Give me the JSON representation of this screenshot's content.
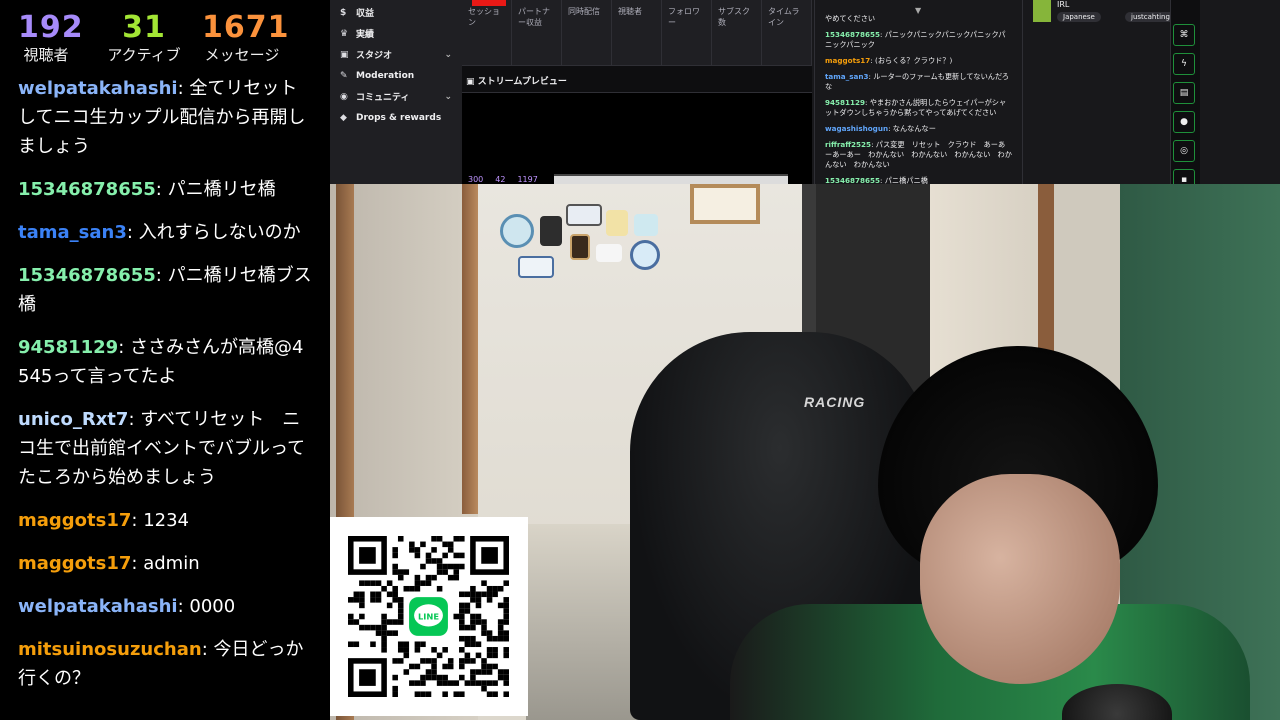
{
  "stats": {
    "viewers": {
      "value": "192",
      "label": "視聴者",
      "color": "#a78bfa"
    },
    "active": {
      "value": "31",
      "label": "アクティブ",
      "color": "#a3e635"
    },
    "messages": {
      "value": "1671",
      "label": "メッセージ",
      "color": "#fb923c"
    }
  },
  "chat": [
    {
      "user": "welpatakahashi",
      "color": "#8ab4f8",
      "text": "全てリセットしてニコ生カップル配信から再開しましょう"
    },
    {
      "user": "15346878655",
      "color": "#86efac",
      "text": "パニ橋リセ橋"
    },
    {
      "user": "tama_san3",
      "color": "#3b82f6",
      "text": "入れすらしないのか"
    },
    {
      "user": "15346878655",
      "color": "#86efac",
      "text": "パニ橋リセ橋ブス橋"
    },
    {
      "user": "94581129",
      "color": "#86efac",
      "text": "ささみさんが高橋@4545って言ってたよ"
    },
    {
      "user": "unico_Rxt7",
      "color": "#bfdbfe",
      "text": "すべてリセット　ニコ生で出前館イベントでバブルってたころから始めましょう"
    },
    {
      "user": "maggots17",
      "color": "#f59e0b",
      "text": "1234"
    },
    {
      "user": "maggots17",
      "color": "#f59e0b",
      "text": "admin"
    },
    {
      "user": "welpatakahashi",
      "color": "#8ab4f8",
      "text": "0000"
    },
    {
      "user": "mitsuinosuzuchan",
      "color": "#f59e0b",
      "text": "今日どっか行くの？"
    }
  ],
  "dashboard": {
    "nav": [
      {
        "icon": "$",
        "label": "収益",
        "chevron": ""
      },
      {
        "icon": "♛",
        "label": "実績",
        "chevron": ""
      },
      {
        "icon": "▣",
        "label": "スタジオ",
        "chevron": "⌄"
      },
      {
        "icon": "✎",
        "label": "Moderation",
        "chevron": ""
      },
      {
        "icon": "◉",
        "label": "コミュニティ",
        "chevron": "⌄"
      },
      {
        "icon": "◆",
        "label": "Drops & rewards",
        "chevron": ""
      }
    ],
    "metric_tabs": [
      "セッション",
      "パートナー収益",
      "同時配信",
      "視聴者",
      "フォロワー",
      "サブスク数",
      "タイムライン"
    ],
    "preview_title": "▣ ストリームプレビュー",
    "mini_stats": [
      "300",
      "42",
      "1197"
    ],
    "chat": [
      {
        "user": "",
        "color": "#efeff1",
        "text": "やめてください"
      },
      {
        "user": "15346878655",
        "color": "#86efac",
        "text": "パニックパニックパニックパニックパニックパニック"
      },
      {
        "user": "maggots17",
        "color": "#f59e0b",
        "text": "(おらくる？クラウド？)"
      },
      {
        "user": "tama_san3",
        "color": "#60a5fa",
        "text": "ルーターのファームも更新してないんだろな"
      },
      {
        "user": "94581129",
        "color": "#86efac",
        "text": "やまおかさん説明したらウェイパーがシャットダウンしちゃうから黙ってやってあげてください"
      },
      {
        "user": "wagashishogun",
        "color": "#60a5fa",
        "text": "なんなんなー"
      },
      {
        "user": "riffraff2525",
        "color": "#86efac",
        "text": "パス変更　リセット　クラウド　あーあーあーあー　わかんない　わかんない　わかんない　わかんない　わかんない"
      },
      {
        "user": "15346878655",
        "color": "#86efac",
        "text": "パニ橋パニ橋"
      }
    ],
    "category": "IRL",
    "tags": [
      "Japanese",
      "justcahting"
    ]
  },
  "webcam": {
    "chair_logo": "RACING"
  }
}
